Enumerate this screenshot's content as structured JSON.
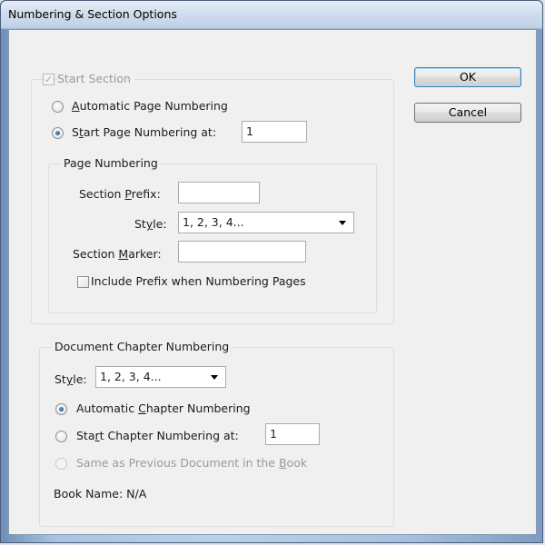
{
  "window": {
    "title": "Numbering & Section Options"
  },
  "start_section": {
    "label": "Start Section",
    "checked": true,
    "disabled": true,
    "automatic_page_numbering": {
      "pre": "",
      "key": "A",
      "post": "utomatic Page Numbering",
      "selected": false
    },
    "start_page_numbering": {
      "pre": "S",
      "key": "t",
      "post": "art Page Numbering at:",
      "selected": true,
      "value": "1"
    }
  },
  "page_numbering": {
    "legend": "Page Numbering",
    "section_prefix": {
      "pre": "Section ",
      "key": "P",
      "post": "refix:",
      "value": ""
    },
    "style": {
      "pre": "St",
      "key": "y",
      "post": "le:",
      "value": "1, 2, 3, 4..."
    },
    "section_marker": {
      "pre": "Section ",
      "key": "M",
      "post": "arker:",
      "value": ""
    },
    "include_prefix": {
      "label": "Include Prefix when Numbering Pages",
      "checked": false
    }
  },
  "chapter_numbering": {
    "legend": "Document Chapter Numbering",
    "style": {
      "pre": "St",
      "key": "y",
      "post": "le:",
      "value": "1, 2, 3, 4..."
    },
    "automatic_chapter": {
      "pre": "Automatic ",
      "key": "C",
      "post": "hapter Numbering",
      "selected": true
    },
    "start_chapter": {
      "pre": "Sta",
      "key": "r",
      "post": "t Chapter Numbering at:",
      "selected": false,
      "value": "1"
    },
    "same_as_previous": {
      "pre": "Same as Previous Document in the ",
      "key": "B",
      "post": "ook",
      "selected": false,
      "disabled": true
    },
    "book_name": "Book Name: N/A"
  },
  "buttons": {
    "ok": "OK",
    "cancel": "Cancel"
  }
}
